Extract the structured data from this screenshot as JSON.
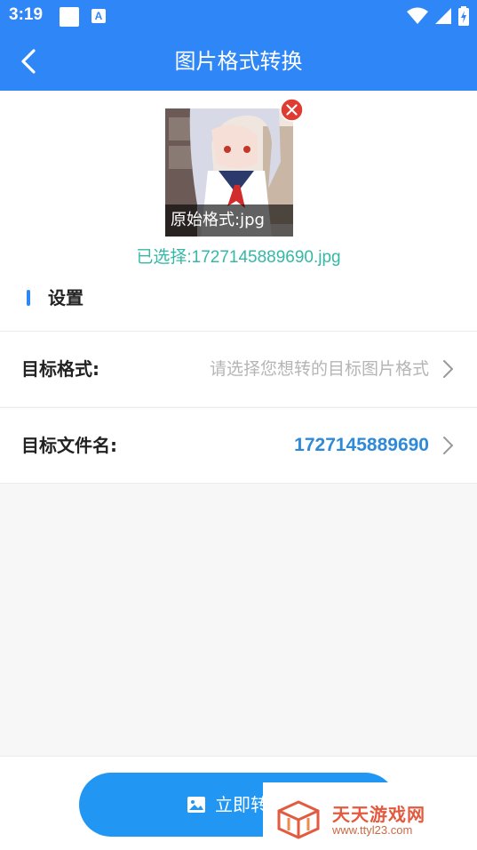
{
  "status_bar": {
    "time": "3:19",
    "a_icon": "A",
    "icons": [
      "wifi-icon",
      "signal-icon",
      "battery-icon"
    ]
  },
  "app_bar": {
    "back_icon": "back-chevron-icon",
    "title": "图片格式转换"
  },
  "image_card": {
    "caption": "原始格式:jpg",
    "remove_icon": "close-circle-icon",
    "selected_file": "已选择:1727145889690.jpg"
  },
  "settings": {
    "section_title": "设置",
    "rows": [
      {
        "label": "目标格式:",
        "value": "请选择您想转的目标图片格式",
        "is_placeholder": true
      },
      {
        "label": "目标文件名:",
        "value": "1727145889690",
        "is_placeholder": false
      }
    ]
  },
  "convert": {
    "label": "立即转",
    "icon": "image-icon"
  },
  "watermark": {
    "title": "天天游戏网",
    "url": "www.ttyl23.com"
  },
  "colors": {
    "primary": "#2f86f6",
    "button": "#2196f3",
    "accent_teal": "#35b8a6",
    "value_blue": "#2e8ad8",
    "placeholder": "#b5b5b5",
    "danger": "#e03b30"
  }
}
